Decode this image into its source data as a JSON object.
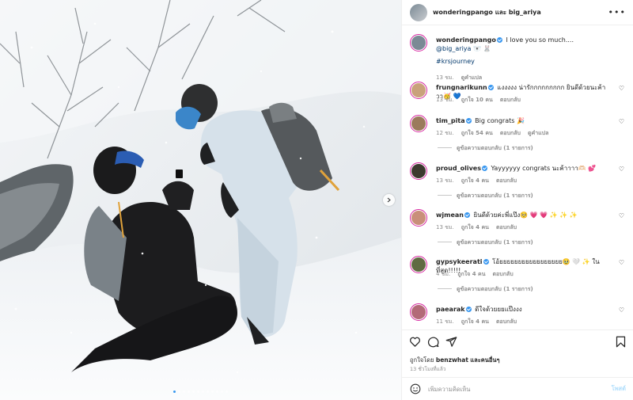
{
  "header": {
    "author": "wonderingpango",
    "connector": "และ",
    "collaborator": "big_ariya",
    "more_icon": "more-horizontal-icon"
  },
  "caption": {
    "username": "wonderingpango",
    "text": "I love you so much....",
    "mention": "@big_ariya",
    "emoji": "🐻‍❄️ 🐰",
    "hashtag": "#krsjourney",
    "time": "13 ชม.",
    "translate": "ดูคำแปล"
  },
  "comments": [
    {
      "username": "frungnarikunn",
      "text": "แงงงงง น่ารักกกกกกกกก ยินดีด้วยนะค้าาา🥳 💙",
      "time": "13 ชม.",
      "likes": "ถูกใจ 10 คน",
      "reply": "ตอบกลับ",
      "avatar_color": "#c9a27b"
    },
    {
      "username": "tim_pita",
      "text": "Big congrats 🎉",
      "time": "12 ชม.",
      "likes": "ถูกใจ 54 คน",
      "reply": "ตอบกลับ",
      "translate": "ดูคำแปล",
      "view_replies": "ดูข้อความตอบกลับ (1 รายการ)",
      "avatar_color": "#9b7b5c"
    },
    {
      "username": "proud_olives",
      "text": "Yayyyyyy congrats นะค้าาาา🫶🏻 💕",
      "time": "13 ชม.",
      "likes": "ถูกใจ 4 คน",
      "reply": "ตอบกลับ",
      "view_replies": "ดูข้อความตอบกลับ (1 รายการ)",
      "avatar_color": "#3c3a2f"
    },
    {
      "username": "wjmean",
      "text": "ยินดีด้วยค่ะพี่แป๊ง🥺 💗 💗 ✨ ✨ ✨",
      "time": "13 ชม.",
      "likes": "ถูกใจ 4 คน",
      "reply": "ตอบกลับ",
      "view_replies": "ดูข้อความตอบกลับ (1 รายการ)",
      "avatar_color": "#c98f7a"
    },
    {
      "username": "gypsykeerati",
      "text": "โอ้ยยยยยยยยยยยยยยยยย🥹 🤍 ✨ ในที่สุด!!!!!",
      "time": "4 ชม.",
      "likes": "ถูกใจ 4 คน",
      "reply": "ตอบกลับ",
      "view_replies": "ดูข้อความตอบกลับ (1 รายการ)",
      "avatar_color": "#5f6b42"
    },
    {
      "username": "paearak",
      "text": "ดีใจด้วยยยแป๊งงง",
      "time": "11 ชม.",
      "likes": "ถูกใจ 4 คน",
      "reply": "ตอบกลับ",
      "avatar_color": "#b36a78"
    }
  ],
  "actions": {
    "icons": [
      "heart-outline-icon",
      "comment-icon",
      "share-icon",
      "bookmark-icon"
    ],
    "liked_by_prefix": "ถูกใจโดย",
    "liked_by_user": "benzwhat",
    "liked_by_suffix": "และคนอื่นๆ",
    "time_ago": "13 ชั่วโมงที่แล้ว"
  },
  "composer": {
    "emoji_icon": "emoji-icon",
    "placeholder": "เพิ่มความคิดเห็น",
    "post_label": "โพสต์"
  },
  "carousel": {
    "slides": 12,
    "active_index": 0
  },
  "colors": {
    "verified": "#3897f0",
    "link": "#00376b",
    "story_ring": "#d6249f",
    "post_disabled": "#b2dffc"
  }
}
